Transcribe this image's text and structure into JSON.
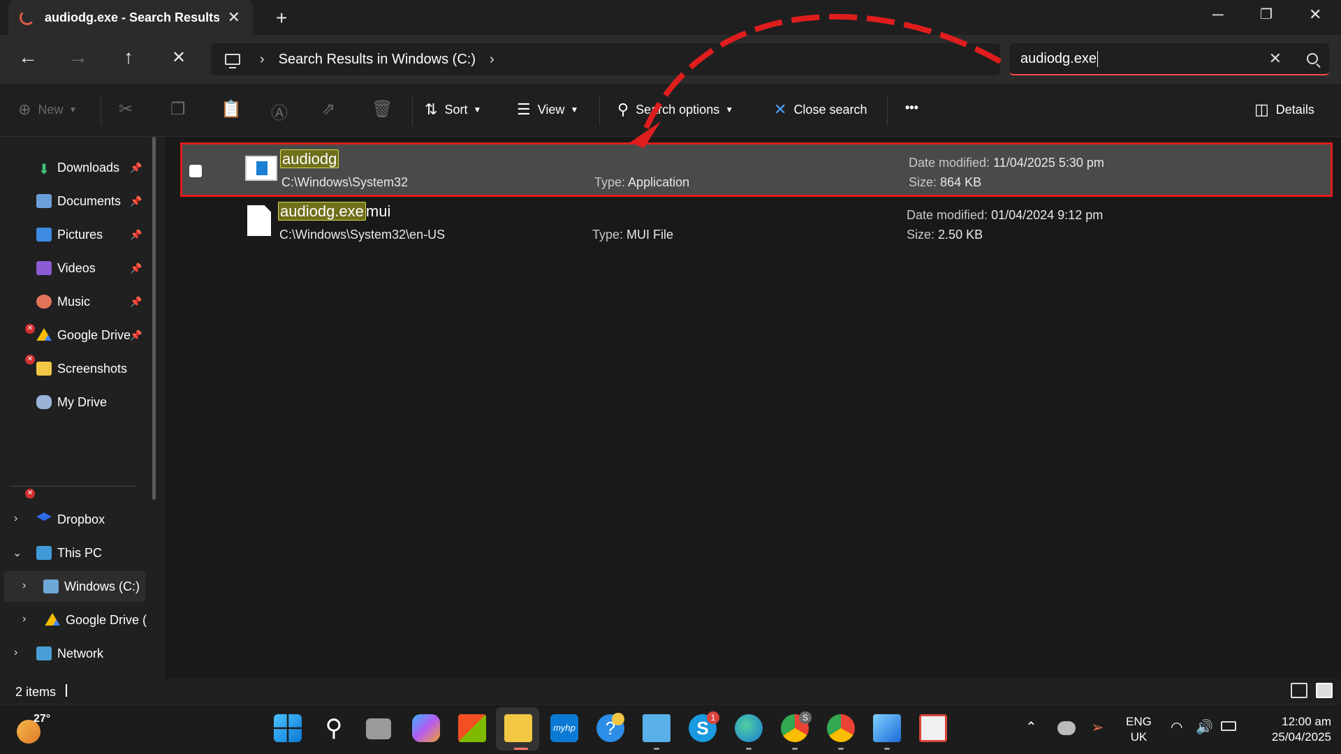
{
  "window": {
    "tab_title": "audiodg.exe - Search Results in Windows (C:)",
    "tab_close_icon": "close-icon",
    "new_tab_icon": "plus-icon",
    "controls": [
      "minimize-icon",
      "restore-icon",
      "close-icon"
    ]
  },
  "address": {
    "crumb_root_icon": "this-pc-icon",
    "crumb": "Search Results in Windows (C:)"
  },
  "search": {
    "value": "audiodg.exe"
  },
  "toolbar": {
    "new_label": "New",
    "sort_label": "Sort",
    "view_label": "View",
    "search_options_label": "Search options",
    "close_search_label": "Close search",
    "more_label": "•••",
    "details_label": "Details"
  },
  "sidebar": {
    "quick_access": [
      {
        "label": "Downloads",
        "icon": "download-icon",
        "pinned": true,
        "error": false
      },
      {
        "label": "Documents",
        "icon": "documents-icon",
        "pinned": true,
        "error": true
      },
      {
        "label": "Pictures",
        "icon": "pictures-icon",
        "pinned": true,
        "error": true
      },
      {
        "label": "Videos",
        "icon": "videos-icon",
        "pinned": true,
        "error": false
      },
      {
        "label": "Music",
        "icon": "music-icon",
        "pinned": true,
        "error": false
      },
      {
        "label": "Google Drive",
        "icon": "google-drive-icon",
        "pinned": true,
        "error": false
      },
      {
        "label": "Screenshots",
        "icon": "folder-icon",
        "pinned": false,
        "error": true
      },
      {
        "label": "My Drive",
        "icon": "cloud-drive-icon",
        "pinned": false,
        "error": false
      }
    ],
    "tree": [
      {
        "label": "Dropbox",
        "icon": "dropbox-icon",
        "expanded": false
      },
      {
        "label": "This PC",
        "icon": "this-pc-icon",
        "expanded": true
      },
      {
        "label": "Windows (C:)",
        "icon": "drive-icon",
        "expanded": false,
        "selected": true
      },
      {
        "label": "Google Drive (",
        "icon": "google-drive-icon",
        "expanded": false
      },
      {
        "label": "Network",
        "icon": "network-icon",
        "expanded": false
      }
    ]
  },
  "results": [
    {
      "name_highlight": "audiodg",
      "name_rest": "",
      "path": "C:\\Windows\\System32",
      "type_label": "Type:",
      "type": "Application",
      "date_label": "Date modified:",
      "date": "11/04/2025 5:30 pm",
      "size_label": "Size:",
      "size": "864 KB",
      "selected": true
    },
    {
      "name_highlight": "audiodg.exe",
      "name_rest": "mui",
      "path": "C:\\Windows\\System32\\en-US",
      "type_label": "Type:",
      "type": "MUI File",
      "date_label": "Date modified:",
      "date": "01/04/2024 9:12 pm",
      "size_label": "Size:",
      "size": "2.50 KB",
      "selected": false
    }
  ],
  "status": {
    "count": "2 items"
  },
  "taskbar": {
    "weather_temp": "27°",
    "apps": [
      "start-icon",
      "search-icon",
      "task-view-icon",
      "copilot-icon",
      "store-icon",
      "file-explorer-icon",
      "myhp-icon",
      "help-icon",
      "notepad-icon",
      "skype-icon",
      "edge-icon",
      "chrome-icon",
      "chrome-profile-icon",
      "photos-icon",
      "snipping-tool-icon"
    ],
    "myhp_text": "myhp",
    "skype_badge": "1",
    "chrome_badge": "S",
    "lang_line1": "ENG",
    "lang_line2": "UK",
    "time": "12:00 am",
    "date": "25/04/2025"
  },
  "colors": {
    "highlight_box": "#e01d1d",
    "arrow": "#e01d1d",
    "match_highlight": "#6f6f1c"
  }
}
